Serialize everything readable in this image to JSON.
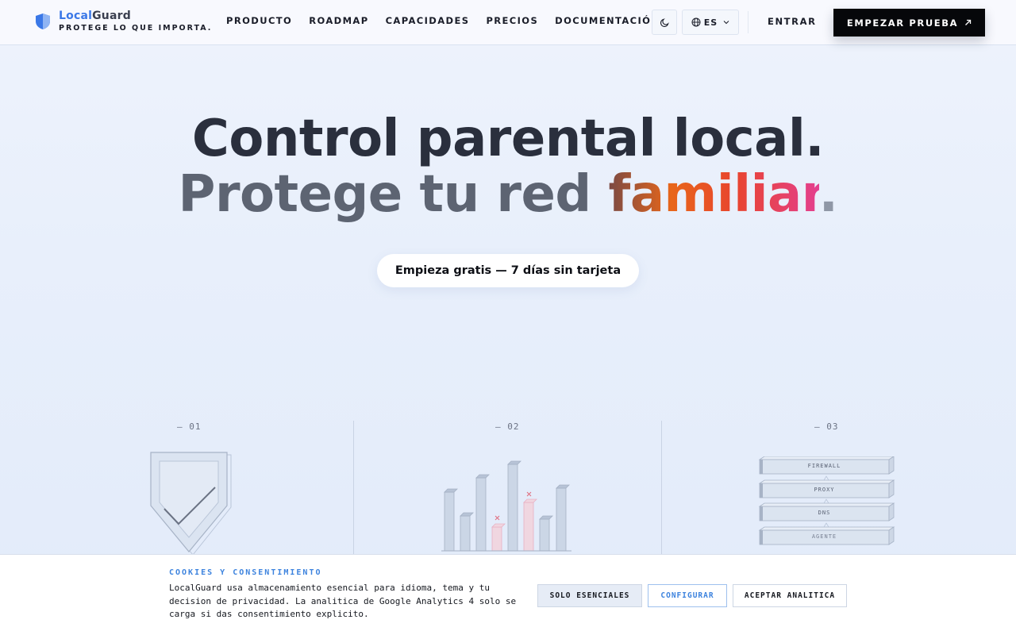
{
  "brand": {
    "name_part1": "Local",
    "name_part2": "Guard",
    "tagline": "PROTEGE LO QUE IMPORTA.",
    "accent_color": "#3b78e7"
  },
  "nav": {
    "items": [
      "PRODUCTO",
      "ROADMAP",
      "CAPACIDADES",
      "PRECIOS",
      "DOCUMENTACIÓN"
    ],
    "theme_icon": "moon-icon",
    "language": "ES",
    "login": "ENTRAR",
    "trial_cta": "EMPEZAR PRUEBA"
  },
  "hero": {
    "line1": "Control parental local.",
    "line2_prefix": "Protege tu red ",
    "line2_highlight": "familiar",
    "line2_suffix": ".",
    "cta": "Empieza gratis — 7 días sin tarjeta"
  },
  "features": [
    {
      "num": "— 01",
      "illustration": "shield-check-icon"
    },
    {
      "num": "— 02",
      "illustration": "bar-chart-illustration"
    },
    {
      "num": "— 03",
      "illustration": "layer-stack-illustration",
      "layers": [
        "FIREWALL",
        "PROXY",
        "DNS",
        "AGENTE"
      ]
    }
  ],
  "cookie": {
    "title": "COOKIES Y CONSENTIMIENTO",
    "text": "LocalGuard usa almacenamiento esencial para idioma, tema y tu decision de privacidad. La analitica de Google Analytics 4 solo se carga si das consentimiento explicito.",
    "btn_essential": "SOLO ESENCIALES",
    "btn_configure": "CONFIGURAR",
    "btn_accept": "ACEPTAR ANALITICA"
  }
}
